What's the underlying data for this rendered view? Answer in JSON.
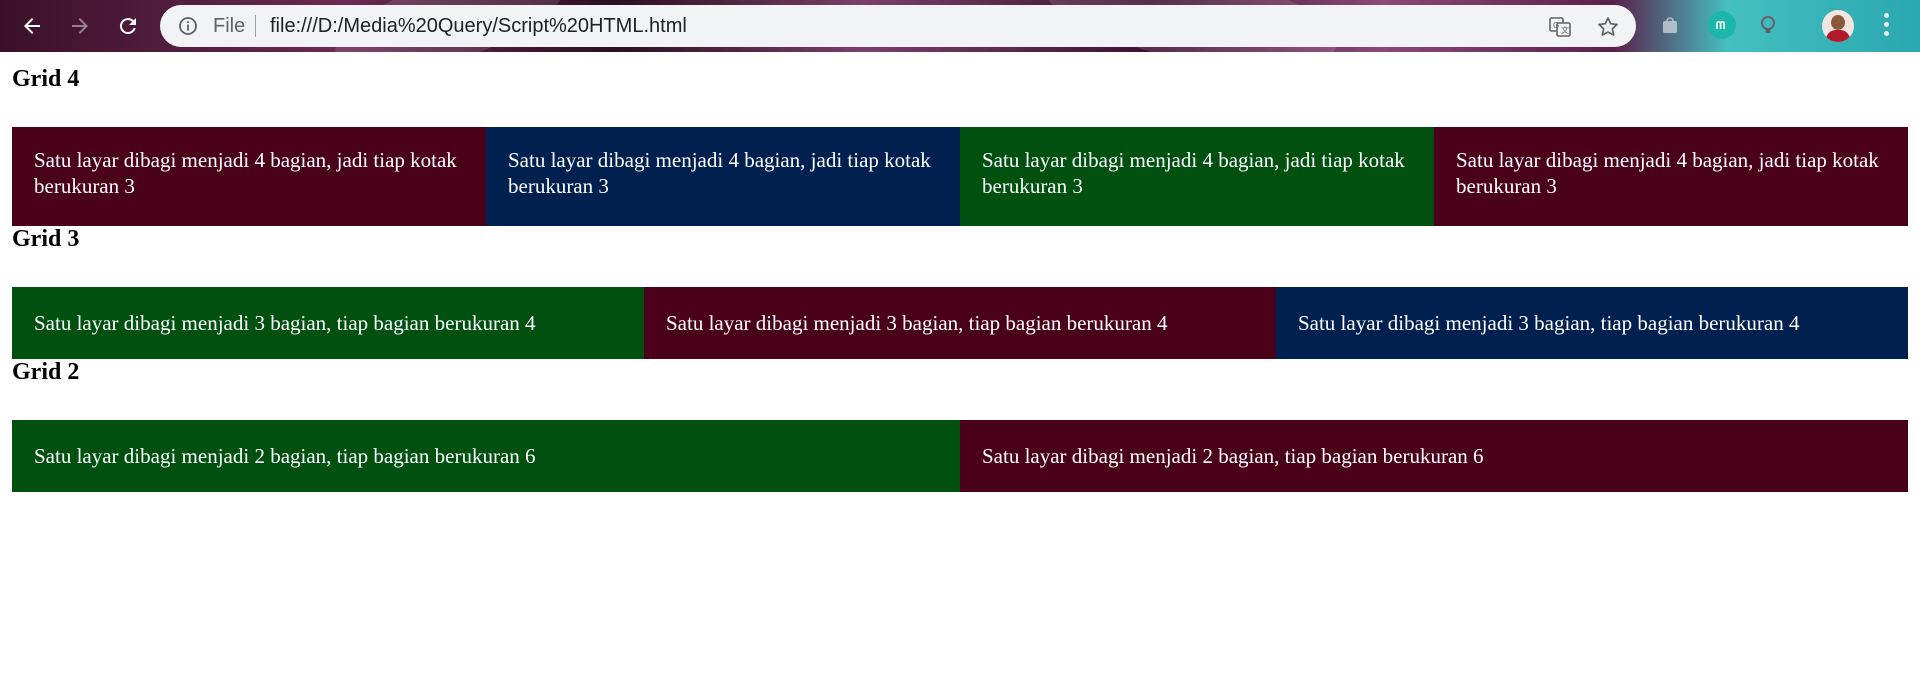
{
  "browser": {
    "url_scheme_label": "File",
    "url": "file:///D:/Media%20Query/Script%20HTML.html",
    "icons": {
      "back": "back-arrow-icon",
      "forward": "forward-arrow-icon",
      "reload": "reload-icon",
      "info": "info-icon",
      "translate": "translate-icon",
      "bookmark": "star-icon",
      "menu": "more-vert-icon"
    }
  },
  "colors": {
    "maroon": "#4a0018",
    "navy": "#002050",
    "green": "#005010"
  },
  "sections": [
    {
      "title": "Grid 4",
      "cells": [
        {
          "text": "Satu layar dibagi menjadi 4 bagian, jadi tiap kotak berukuran 3",
          "color": "#4a0018"
        },
        {
          "text": "Satu layar dibagi menjadi 4 bagian, jadi tiap kotak berukuran 3",
          "color": "#002050"
        },
        {
          "text": "Satu layar dibagi menjadi 4 bagian, jadi tiap kotak berukuran 3",
          "color": "#005010"
        },
        {
          "text": "Satu layar dibagi menjadi 4 bagian, jadi tiap kotak berukuran 3",
          "color": "#4a0018"
        }
      ]
    },
    {
      "title": "Grid 3",
      "cells": [
        {
          "text": "Satu layar dibagi menjadi 3 bagian, tiap bagian berukuran 4",
          "color": "#005010"
        },
        {
          "text": "Satu layar dibagi menjadi 3 bagian, tiap bagian berukuran 4",
          "color": "#4a0018"
        },
        {
          "text": "Satu layar dibagi menjadi 3 bagian, tiap bagian berukuran 4",
          "color": "#002050"
        }
      ]
    },
    {
      "title": "Grid 2",
      "cells": [
        {
          "text": "Satu layar dibagi menjadi 2 bagian, tiap bagian berukuran 6",
          "color": "#005010"
        },
        {
          "text": "Satu layar dibagi menjadi 2 bagian, tiap bagian berukuran 6",
          "color": "#4a0018"
        }
      ]
    }
  ]
}
